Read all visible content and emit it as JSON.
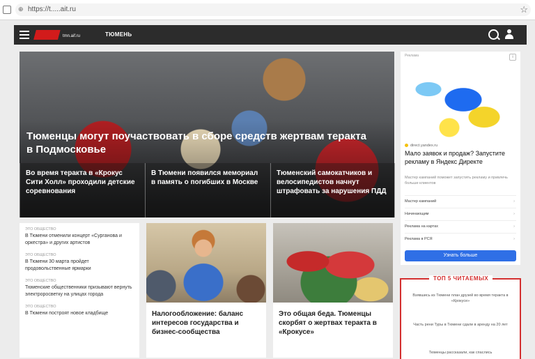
{
  "browser": {
    "url": "https://t.....ait.ru"
  },
  "header": {
    "city": "ТЮМЕНЬ",
    "logo_sub": "tmn.aif.ru"
  },
  "hero": {
    "title": "Тюменцы могут поучаствовать в сборе средств жертвам теракта в Подмосковье",
    "subs": [
      "Во время теракта в «Крокус Сити Холл» проходили детские соревнования",
      "В Тюмени появился мемориал в память о погибших в Москве",
      "Тюменский самокатчиков и велосипедистов начнут штрафовать за нарушения ПДД"
    ]
  },
  "news_list": [
    {
      "tag": "ЭТО ОБЩЕСТВО",
      "text": "В Тюмени отменили концерт «Сурганова и оркестра» и других артистов"
    },
    {
      "tag": "ЭТО ОБЩЕСТВО",
      "text": "В Тюмени 30 марта пройдет продовольственные ярмарки"
    },
    {
      "tag": "ЭТО ОБЩЕСТВО",
      "text": "Тюменские общественники призывают вернуть электроросветку на улицах города"
    },
    {
      "tag": "ЭТО ОБЩЕСТВО",
      "text": "В Тюмени построят новое кладбище"
    }
  ],
  "cards": [
    {
      "title": "Налогообложение: баланс интересов государства и бизнес-сообщества"
    },
    {
      "title": "Это общая беда. Тюменцы скорбят о жертвах теракта в «Крокусе»"
    }
  ],
  "ad": {
    "label": "Реклама",
    "domain": "direct.yandex.ru",
    "title": "Мало заявок и продаж? Запустите рекламу в Яндекс Директе",
    "desc": "Мастер кампаний поможет запустить рекламу и привлечь больше клиентов",
    "links": [
      "Мастер кампаний",
      "Начинающим",
      "Реклама на картах",
      "Реклама в РСЯ"
    ],
    "cta": "Узнать больше"
  },
  "top": {
    "title": "ТОП 5 ЧИТАЕМЫХ",
    "items": [
      "Взявшись из Тюмени план друзей во время теракта в «Крокусе»",
      "Часть рени Туры в Тюмени сдали в аренду на 20 лет",
      "Тюменцы рассказали, как спаслись"
    ]
  }
}
